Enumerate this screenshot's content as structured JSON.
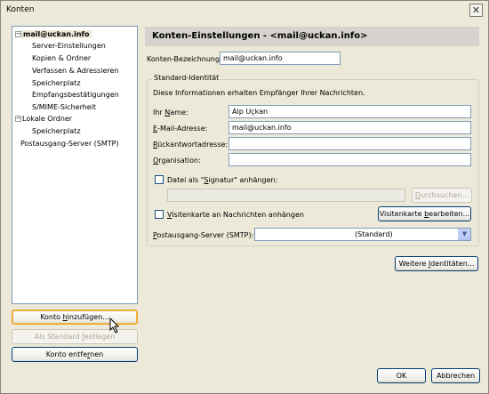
{
  "window": {
    "title": "Konten",
    "close_glyph": "✕"
  },
  "tree": {
    "items": [
      {
        "label": "mail@uckan.info",
        "expander": "−"
      },
      {
        "label": "Server-Einstellungen"
      },
      {
        "label": "Kopien & Ordner"
      },
      {
        "label": "Verfassen & Adressieren"
      },
      {
        "label": "Speicherplatz"
      },
      {
        "label": "Empfangsbestätigungen"
      },
      {
        "label": "S/MIME-Sicherheit"
      },
      {
        "label": "Lokale Ordner",
        "expander": "−"
      },
      {
        "label": "Speicherplatz"
      },
      {
        "label": "Postausgang-Server (SMTP)"
      }
    ]
  },
  "left_buttons": {
    "add": {
      "pre": "Konto ",
      "acc": "h",
      "post": "inzufügen..."
    },
    "default": {
      "pre": "Als Standard ",
      "acc": "f",
      "post": "estlegen"
    },
    "remove": {
      "pre": "Konto entfe",
      "acc": "r",
      "post": "nen"
    }
  },
  "header": {
    "title": "Konten-Einstellungen - <mail@uckan.info>"
  },
  "account_name": {
    "label": "Konten-Bezeichnung:",
    "value": "mail@uckan.info"
  },
  "identity": {
    "legend": "Standard-Identität",
    "description": "Diese Informationen erhalten Empfänger Ihrer Nachrichten.",
    "name": {
      "pre": "Ihr ",
      "acc": "N",
      "post": "ame:",
      "value": "Alp Uçkan"
    },
    "email": {
      "pre": "",
      "acc": "E",
      "post": "-Mail-Adresse:",
      "value": "mail@uckan.info"
    },
    "reply": {
      "pre": "",
      "acc": "R",
      "post": "ückantwortadresse:",
      "value": ""
    },
    "org": {
      "pre": "",
      "acc": "O",
      "post": "rganisation:",
      "value": ""
    },
    "signature": {
      "pre": "Datei als \"",
      "acc": "S",
      "post": "ignatur\" anhängen:",
      "value": ""
    },
    "browse": {
      "pre": "",
      "acc": "D",
      "post": "urchsuchen..."
    },
    "vcard": {
      "pre": "",
      "acc": "V",
      "post": "isitenkarte an Nachrichten anhängen"
    },
    "vcard_edit": {
      "pre": "Visitenkarte ",
      "acc": "b",
      "post": "earbeiten..."
    },
    "smtp": {
      "pre": "",
      "acc": "P",
      "post": "ostausgang-Server (SMTP):",
      "value": "(Standard)"
    }
  },
  "more_identities": {
    "pre": "Weitere ",
    "acc": "I",
    "post": "dentitäten..."
  },
  "dialog_buttons": {
    "ok": "OK",
    "cancel": "Abbrechen"
  }
}
